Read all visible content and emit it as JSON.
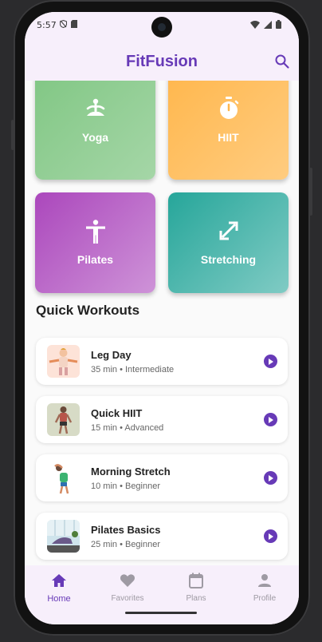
{
  "status_bar": {
    "time": "5:57"
  },
  "app_bar": {
    "title": "FitFusion",
    "search_icon": "search-icon"
  },
  "categories": [
    {
      "label": "Yoga",
      "icon": "yoga-pose-icon",
      "colors": [
        "#81c784",
        "#a5d6a7"
      ]
    },
    {
      "label": "HIIT",
      "icon": "timer-icon",
      "colors": [
        "#ffb74d",
        "#ffcc80"
      ]
    },
    {
      "label": "Pilates",
      "icon": "person-standing-icon",
      "colors": [
        "#ab47bc",
        "#ce93d8"
      ]
    },
    {
      "label": "Stretching",
      "icon": "expand-arrows-icon",
      "colors": [
        "#26a69a",
        "#80cbc4"
      ]
    }
  ],
  "quick_workouts": {
    "title": "Quick Workouts",
    "items": [
      {
        "title": "Leg Day",
        "meta": "35 min • Intermediate"
      },
      {
        "title": "Quick HIIT",
        "meta": "15 min • Advanced"
      },
      {
        "title": "Morning Stretch",
        "meta": "10 min • Beginner"
      },
      {
        "title": "Pilates Basics",
        "meta": "25 min • Beginner"
      }
    ]
  },
  "bottom_nav": {
    "items": [
      {
        "label": "Home",
        "icon": "home-icon",
        "active": true
      },
      {
        "label": "Favorites",
        "icon": "heart-icon",
        "active": false
      },
      {
        "label": "Plans",
        "icon": "calendar-icon",
        "active": false
      },
      {
        "label": "Profile",
        "icon": "person-icon",
        "active": false
      }
    ]
  },
  "colors": {
    "accent": "#673ab7",
    "surface": "#f7effb",
    "background": "#fafafa"
  }
}
